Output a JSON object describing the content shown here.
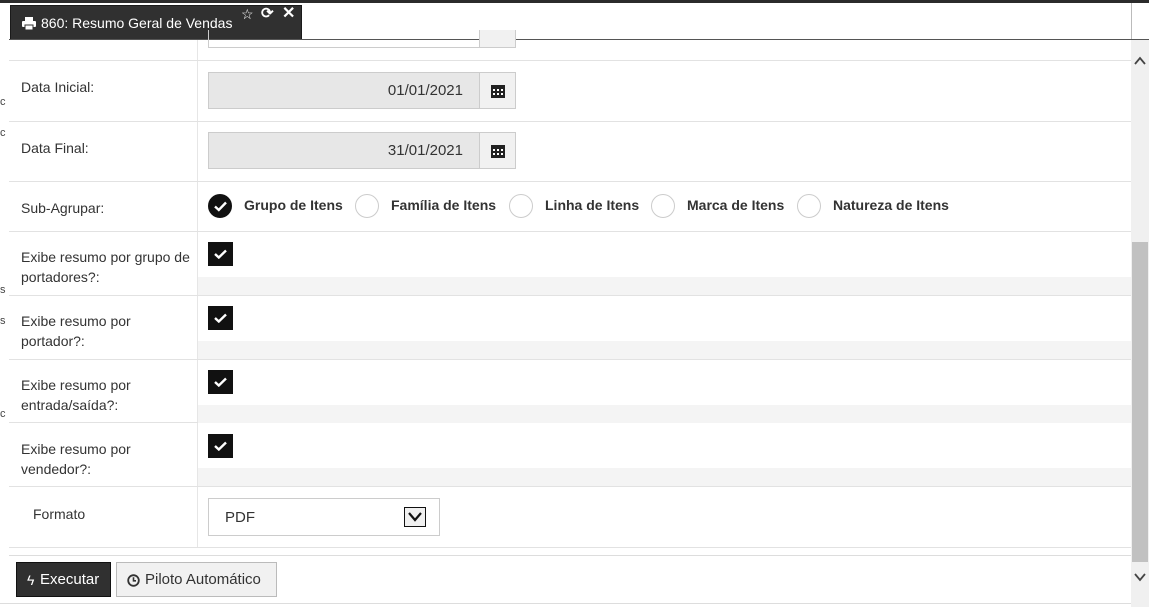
{
  "window": {
    "tab_title": "860: Resumo Geral de Vendas"
  },
  "icons": {
    "tab_icon": "printer-icon",
    "favorite": "star-icon",
    "refresh": "refresh-icon",
    "close": "close-icon",
    "calendar": "calendar-icon",
    "execute": "bolt-icon",
    "autopilot": "clock-icon"
  },
  "form": {
    "data_inicial": {
      "label": "Data Inicial:",
      "value": "01/01/2021"
    },
    "data_final": {
      "label": "Data Final:",
      "value": "31/01/2021"
    },
    "sub_agrupar": {
      "label": "Sub-Agrupar:",
      "options": [
        {
          "label": "Grupo de Itens",
          "selected": true
        },
        {
          "label": "Família de Itens",
          "selected": false
        },
        {
          "label": "Linha de Itens",
          "selected": false
        },
        {
          "label": "Marca de Itens",
          "selected": false
        },
        {
          "label": "Natureza de Itens",
          "selected": false
        }
      ]
    },
    "checks": [
      {
        "label_line1": "Exibe resumo por grupo de",
        "label_line2": "portadores?:",
        "checked": true
      },
      {
        "label_line1": "Exibe resumo por",
        "label_line2": "portador?:",
        "checked": true
      },
      {
        "label_line1": "Exibe resumo por",
        "label_line2": "entrada/saída?:",
        "checked": true
      },
      {
        "label_line1": "Exibe resumo por",
        "label_line2": "vendedor?:",
        "checked": true
      }
    ],
    "formato": {
      "label": "Formato",
      "value": "PDF"
    }
  },
  "footer": {
    "execute_label": "Executar",
    "autopilot_label": "Piloto Automático"
  },
  "colors": {
    "dark": "#303030",
    "input_bg": "#e7e7e7",
    "border": "#cccccc"
  }
}
